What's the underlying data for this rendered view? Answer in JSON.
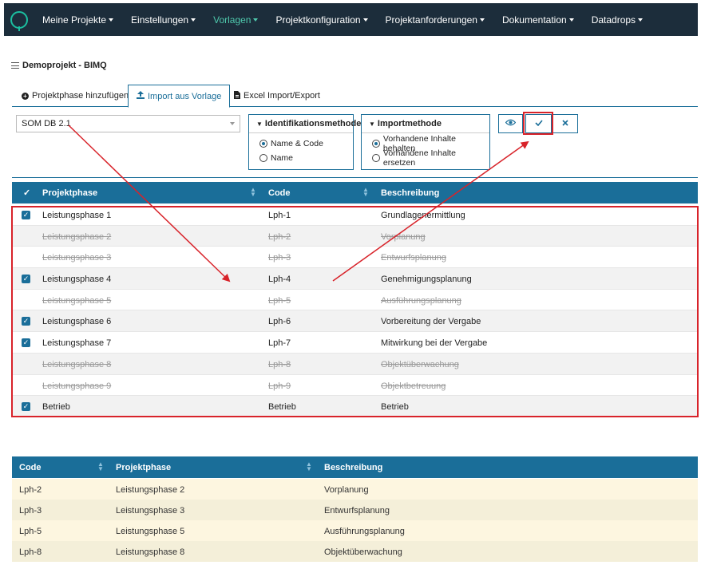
{
  "nav": {
    "items": [
      {
        "label": "Meine Projekte",
        "active": false
      },
      {
        "label": "Einstellungen",
        "active": false
      },
      {
        "label": "Vorlagen",
        "active": true
      },
      {
        "label": "Projektkonfiguration",
        "active": false
      },
      {
        "label": "Projektanforderungen",
        "active": false
      },
      {
        "label": "Dokumentation",
        "active": false
      },
      {
        "label": "Datadrops",
        "active": false
      }
    ]
  },
  "project": {
    "title": "Demoprojekt - BIMQ"
  },
  "tabs": [
    {
      "label": "Projektphase hinzufügen",
      "icon": "plus-circle-icon"
    },
    {
      "label": "Import aus Vorlage",
      "icon": "upload-icon",
      "active": true
    },
    {
      "label": "Excel Import/Export",
      "icon": "file-icon"
    }
  ],
  "template_select": {
    "value": "SOM DB 2.1"
  },
  "identification": {
    "title": "Identifikationsmethode",
    "options": [
      {
        "label": "Name & Code",
        "selected": true
      },
      {
        "label": "Name",
        "selected": false
      }
    ]
  },
  "import_method": {
    "title": "Importmethode",
    "options": [
      {
        "label": "Vorhandene Inhalte behalten",
        "selected": true
      },
      {
        "label": "Vorhandene Inhalte ersetzen",
        "selected": false
      }
    ]
  },
  "buttons": {
    "preview": "eye-icon",
    "confirm": "check-icon",
    "cancel": "close-icon"
  },
  "colors": {
    "nav_bg": "#1c2d3b",
    "accent": "#1a6e99",
    "active_nav": "#4fc9ad",
    "highlight": "#d8232a"
  },
  "table": {
    "headers": {
      "select": "✓",
      "phase": "Projektphase",
      "code": "Code",
      "description": "Beschreibung"
    },
    "rows": [
      {
        "checked": true,
        "phase": "Leistungsphase 1",
        "code": "Lph-1",
        "description": "Grundlagenermittlung"
      },
      {
        "checked": false,
        "phase": "Leistungsphase 2",
        "code": "Lph-2",
        "description": "Vorplanung"
      },
      {
        "checked": false,
        "phase": "Leistungsphase 3",
        "code": "Lph-3",
        "description": "Entwurfsplanung"
      },
      {
        "checked": true,
        "phase": "Leistungsphase 4",
        "code": "Lph-4",
        "description": "Genehmigungsplanung"
      },
      {
        "checked": false,
        "phase": "Leistungsphase 5",
        "code": "Lph-5",
        "description": "Ausführungsplanung"
      },
      {
        "checked": true,
        "phase": "Leistungsphase 6",
        "code": "Lph-6",
        "description": "Vorbereitung der Vergabe"
      },
      {
        "checked": true,
        "phase": "Leistungsphase 7",
        "code": "Lph-7",
        "description": "Mitwirkung bei der Vergabe"
      },
      {
        "checked": false,
        "phase": "Leistungsphase 8",
        "code": "Lph-8",
        "description": "Objektüberwachung"
      },
      {
        "checked": false,
        "phase": "Leistungsphase 9",
        "code": "Lph-9",
        "description": "Objektbetreuung"
      },
      {
        "checked": true,
        "phase": "Betrieb",
        "code": "Betrieb",
        "description": "Betrieb"
      }
    ]
  },
  "table2": {
    "headers": {
      "code": "Code",
      "phase": "Projektphase",
      "description": "Beschreibung"
    },
    "rows": [
      {
        "code": "Lph-2",
        "phase": "Leistungsphase 2",
        "description": "Vorplanung"
      },
      {
        "code": "Lph-3",
        "phase": "Leistungsphase 3",
        "description": "Entwurfsplanung"
      },
      {
        "code": "Lph-5",
        "phase": "Leistungsphase 5",
        "description": "Ausführungsplanung"
      },
      {
        "code": "Lph-8",
        "phase": "Leistungsphase 8",
        "description": "Objektüberwachung"
      }
    ]
  }
}
